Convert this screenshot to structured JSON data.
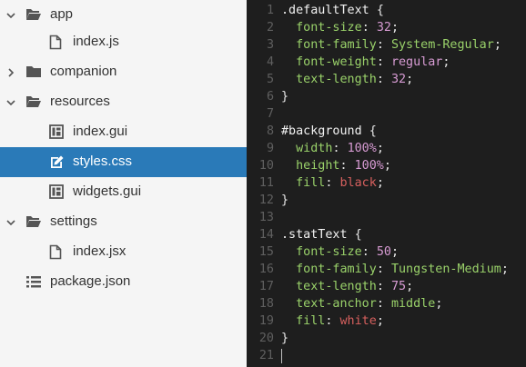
{
  "explorer": {
    "items": [
      {
        "label": "app",
        "kind": "folder-open",
        "depth": 0,
        "expanded": true
      },
      {
        "label": "index.js",
        "kind": "file",
        "depth": 1
      },
      {
        "label": "companion",
        "kind": "folder",
        "depth": 0,
        "expanded": false
      },
      {
        "label": "resources",
        "kind": "folder-open",
        "depth": 0,
        "expanded": true
      },
      {
        "label": "index.gui",
        "kind": "gui",
        "depth": 1
      },
      {
        "label": "styles.css",
        "kind": "css",
        "depth": 1,
        "selected": true
      },
      {
        "label": "widgets.gui",
        "kind": "gui",
        "depth": 1
      },
      {
        "label": "settings",
        "kind": "folder-open",
        "depth": 0,
        "expanded": true
      },
      {
        "label": "index.jsx",
        "kind": "file",
        "depth": 1
      },
      {
        "label": "package.json",
        "kind": "list",
        "depth": 0
      }
    ]
  },
  "editor": {
    "file": "styles.css",
    "lines": [
      {
        "n": "1",
        "parts": [
          {
            "t": ".defaultText ",
            "c": "sel"
          },
          {
            "t": "{",
            "c": "punc"
          }
        ]
      },
      {
        "n": "2",
        "parts": [
          {
            "t": "  font-size",
            "c": "prop"
          },
          {
            "t": ": ",
            "c": "punc"
          },
          {
            "t": "32",
            "c": "val"
          },
          {
            "t": ";",
            "c": "punc"
          }
        ]
      },
      {
        "n": "3",
        "parts": [
          {
            "t": "  font-family",
            "c": "prop"
          },
          {
            "t": ": ",
            "c": "punc"
          },
          {
            "t": "System-Regular",
            "c": "prop"
          },
          {
            "t": ";",
            "c": "punc"
          }
        ]
      },
      {
        "n": "4",
        "parts": [
          {
            "t": "  font-weight",
            "c": "prop"
          },
          {
            "t": ": ",
            "c": "punc"
          },
          {
            "t": "regular",
            "c": "val"
          },
          {
            "t": ";",
            "c": "punc"
          }
        ]
      },
      {
        "n": "5",
        "parts": [
          {
            "t": "  text-length",
            "c": "prop"
          },
          {
            "t": ": ",
            "c": "punc"
          },
          {
            "t": "32",
            "c": "val"
          },
          {
            "t": ";",
            "c": "punc"
          }
        ]
      },
      {
        "n": "6",
        "parts": [
          {
            "t": "}",
            "c": "punc"
          }
        ]
      },
      {
        "n": "7",
        "parts": []
      },
      {
        "n": "8",
        "parts": [
          {
            "t": "#background ",
            "c": "sel"
          },
          {
            "t": "{",
            "c": "punc"
          }
        ]
      },
      {
        "n": "9",
        "parts": [
          {
            "t": "  width",
            "c": "prop"
          },
          {
            "t": ": ",
            "c": "punc"
          },
          {
            "t": "100%",
            "c": "val"
          },
          {
            "t": ";",
            "c": "punc"
          }
        ]
      },
      {
        "n": "10",
        "parts": [
          {
            "t": "  height",
            "c": "prop"
          },
          {
            "t": ": ",
            "c": "punc"
          },
          {
            "t": "100%",
            "c": "val"
          },
          {
            "t": ";",
            "c": "punc"
          }
        ]
      },
      {
        "n": "11",
        "parts": [
          {
            "t": "  fill",
            "c": "prop"
          },
          {
            "t": ": ",
            "c": "punc"
          },
          {
            "t": "black",
            "c": "valr"
          },
          {
            "t": ";",
            "c": "punc"
          }
        ]
      },
      {
        "n": "12",
        "parts": [
          {
            "t": "}",
            "c": "punc"
          }
        ]
      },
      {
        "n": "13",
        "parts": []
      },
      {
        "n": "14",
        "parts": [
          {
            "t": ".statText ",
            "c": "sel"
          },
          {
            "t": "{",
            "c": "punc"
          }
        ]
      },
      {
        "n": "15",
        "parts": [
          {
            "t": "  font-size",
            "c": "prop"
          },
          {
            "t": ": ",
            "c": "punc"
          },
          {
            "t": "50",
            "c": "val"
          },
          {
            "t": ";",
            "c": "punc"
          }
        ]
      },
      {
        "n": "16",
        "parts": [
          {
            "t": "  font-family",
            "c": "prop"
          },
          {
            "t": ": ",
            "c": "punc"
          },
          {
            "t": "Tungsten-Medium",
            "c": "prop"
          },
          {
            "t": ";",
            "c": "punc"
          }
        ]
      },
      {
        "n": "17",
        "parts": [
          {
            "t": "  text-length",
            "c": "prop"
          },
          {
            "t": ": ",
            "c": "punc"
          },
          {
            "t": "75",
            "c": "val"
          },
          {
            "t": ";",
            "c": "punc"
          }
        ]
      },
      {
        "n": "18",
        "parts": [
          {
            "t": "  text-anchor",
            "c": "prop"
          },
          {
            "t": ": ",
            "c": "punc"
          },
          {
            "t": "middle",
            "c": "prop"
          },
          {
            "t": ";",
            "c": "punc"
          }
        ]
      },
      {
        "n": "19",
        "parts": [
          {
            "t": "  fill",
            "c": "prop"
          },
          {
            "t": ": ",
            "c": "punc"
          },
          {
            "t": "white",
            "c": "valr"
          },
          {
            "t": ";",
            "c": "punc"
          }
        ]
      },
      {
        "n": "20",
        "parts": [
          {
            "t": "}",
            "c": "punc"
          }
        ]
      },
      {
        "n": "21",
        "parts": []
      }
    ]
  },
  "colors": {
    "selection": "#2a7ab8",
    "editor_bg": "#1e1e1e",
    "sidebar_bg": "#f5f5f5"
  }
}
